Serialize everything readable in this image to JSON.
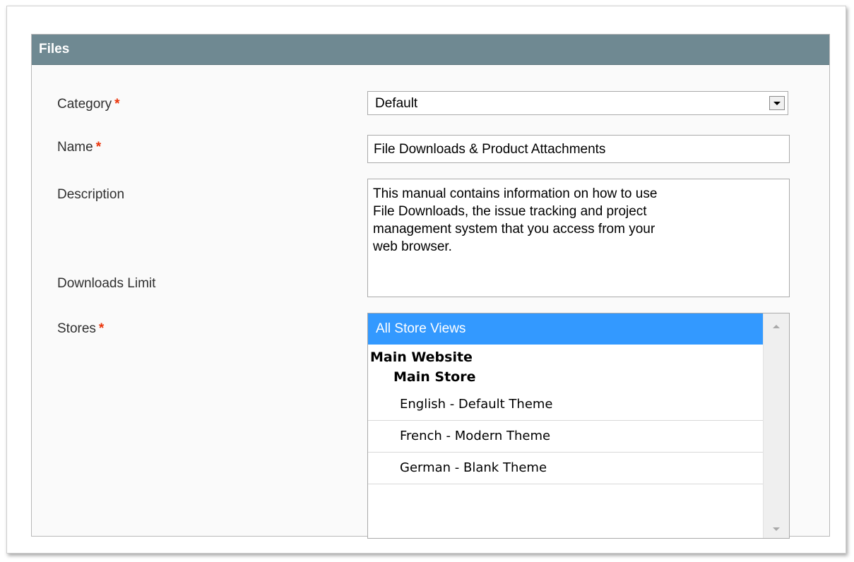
{
  "section": {
    "title": "Files"
  },
  "fields": {
    "category": {
      "label": "Category",
      "required_mark": "*",
      "value": "Default"
    },
    "name": {
      "label": "Name",
      "required_mark": "*",
      "value": "File Downloads & Product Attachments"
    },
    "description": {
      "label": "Description",
      "value": "This manual contains information on how to use\nFile Downloads, the issue tracking and project\nmanagement system that you access from your\nweb browser."
    },
    "downloads_limit": {
      "label": "Downloads Limit"
    },
    "stores": {
      "label": "Stores",
      "required_mark": "*",
      "options": {
        "all": "All Store Views",
        "website": "Main Website",
        "store": "Main Store",
        "views": [
          "English - Default Theme",
          "French - Modern Theme",
          "German - Blank Theme"
        ]
      }
    }
  },
  "colors": {
    "header_bg": "#6f8992",
    "selected_bg": "#3399ff",
    "required": "#eb340a"
  }
}
